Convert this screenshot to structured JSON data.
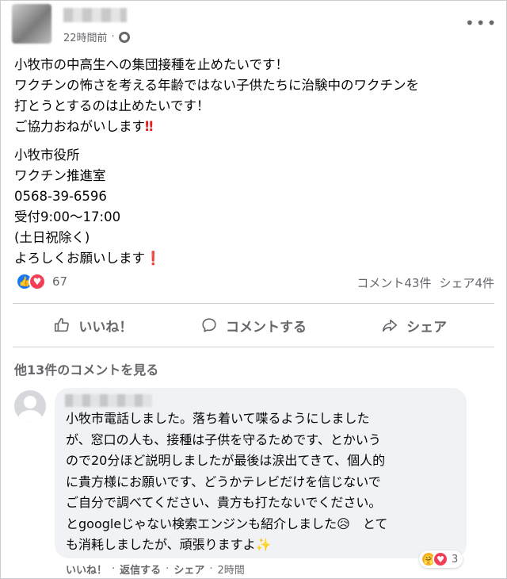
{
  "header": {
    "timestamp": "22時間前",
    "separator": "·",
    "more_label": "•••"
  },
  "post": {
    "lines": [
      "小牧市の中高生への集団接種を止めたいです！",
      "ワクチンの怖さを考える年齢ではない子供たちに治験中のワクチンを",
      "打とうとするのは止めたいです！",
      "ご協力おねがいします"
    ],
    "contact_lines": [
      "小牧市役所",
      "ワクチン推進室",
      "0568-39-6596",
      "受付9:00～17:00",
      "(土日祝除く)",
      "よろしくお願いします"
    ],
    "emoji_double_bang": "‼",
    "emoji_bang": "❗"
  },
  "reactions": {
    "count": "67",
    "like_icon": "👍",
    "love_icon": "♥",
    "comments": "コメント43件",
    "shares": "シェア4件"
  },
  "actions": {
    "like": "いいね！",
    "comment": "コメントする",
    "share": "シェア"
  },
  "more_comments": "他13件のコメントを見る",
  "comment": {
    "lines": [
      "小牧市電話しました。落ち着いて喋るようにしました",
      "が、窓口の人も、接種は子供を守るためです、とかいう",
      "ので20分ほど説明しましたが最後は涙出てきて、個人的",
      "に貴方様にお願いです、どうかテレビだけを信じないで",
      "ご自分で調べてください、貴方も打たないでください。",
      "とgoogleじゃない検索エンジンも紹介しました😥　とて",
      "も消耗しましたが、頑張りますよ✨"
    ],
    "reaction_count": "3",
    "care_icon": "🤗",
    "love_icon": "♥",
    "like_label": "いいね！",
    "reply_label": "返信する",
    "share_label": "シェア",
    "time": "2時間",
    "dot": "·"
  },
  "colors": {
    "like_blue": "#1877f2",
    "love_red": "#f33e58",
    "meta_gray": "#65676b",
    "bubble_bg": "#f0f2f5"
  }
}
